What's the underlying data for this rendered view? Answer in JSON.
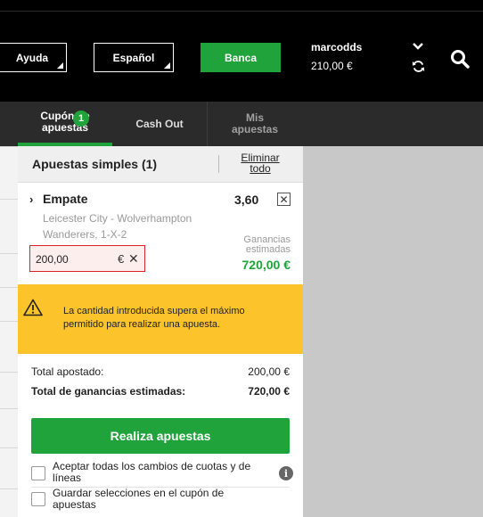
{
  "header": {
    "help_label": "Ayuda",
    "language_label": "Español",
    "bank_label": "Banca",
    "username": "marcodds",
    "balance": "210,00 €",
    "icons": [
      "chevron-down-icon",
      "refresh-icon",
      "search-icon"
    ]
  },
  "tabs": {
    "coupon_label_line1": "Cupón de",
    "coupon_label_line2": "apuestas",
    "coupon_count": "1",
    "cashout_label": "Cash Out",
    "mybets_label_line1": "Mis",
    "mybets_label_line2": "apuestas"
  },
  "betslip": {
    "title": "Apuestas simples (1)",
    "clear_line1": "Eliminar",
    "clear_line2": "todo",
    "selection": {
      "name": "Empate",
      "odds": "3,60",
      "event_line1": "Leicester City - Wolverhampton",
      "event_line2": "Wanderers, 1-X-2",
      "stake": "200,00",
      "currency": "€",
      "potential_label_line1": "Ganancias",
      "potential_label_line2": "estimadas",
      "potential_value": "720,00 €"
    },
    "warning": {
      "line1": "La cantidad introducida supera el máximo",
      "line2": "permitido para realizar una apuesta."
    },
    "summary": {
      "total_staked_label": "Total apostado:",
      "total_staked_value": "200,00 €",
      "total_returns_label": "Total de ganancias estimadas:",
      "total_returns_value": "720,00 €"
    },
    "place_bet_label": "Realiza apuestas",
    "options": {
      "accept_changes_line1": "Aceptar todas los cambios de cuotas y de",
      "accept_changes_line2": "líneas",
      "keep_selections_line1": "Guardar selecciones en el cupón de",
      "keep_selections_line2": "apuestas"
    }
  },
  "colors": {
    "accent_green": "#1fa33a",
    "warning_yellow": "#fcc42a",
    "error_red": "#d9232a",
    "header_black": "#000000"
  }
}
